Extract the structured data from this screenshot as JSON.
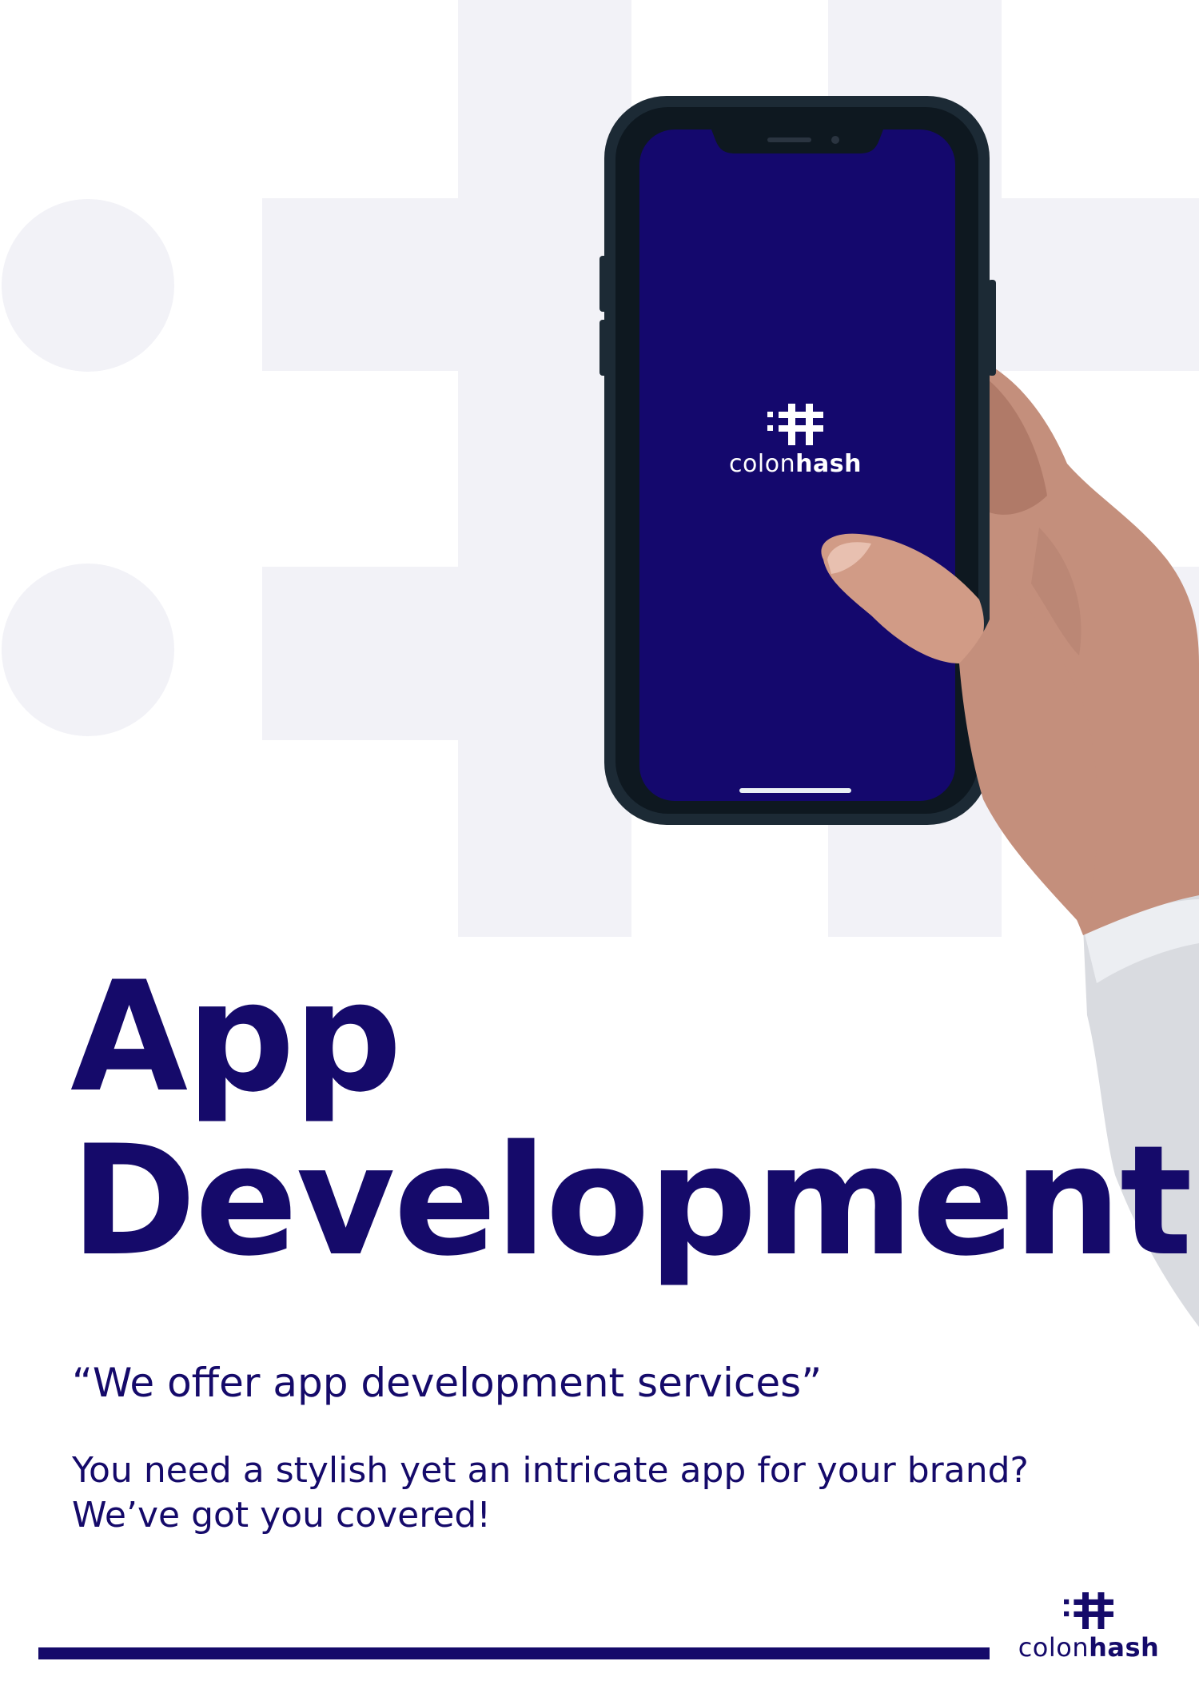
{
  "brand": {
    "name_light": "colon",
    "name_bold": "hash",
    "primary_color": "#150a6a",
    "screen_color": "#14086d",
    "background_shape_color": "#f2f2f7"
  },
  "hero": {
    "title_line1": "App",
    "title_line2": "Development"
  },
  "tagline": "“We offer app development services”",
  "body": {
    "line1": "You need a stylish yet an intricate app for your brand?",
    "line2": "We’ve got you covered!"
  },
  "images": {
    "background": "colonhash-logo-watermark",
    "photo": "hand-holding-smartphone"
  }
}
